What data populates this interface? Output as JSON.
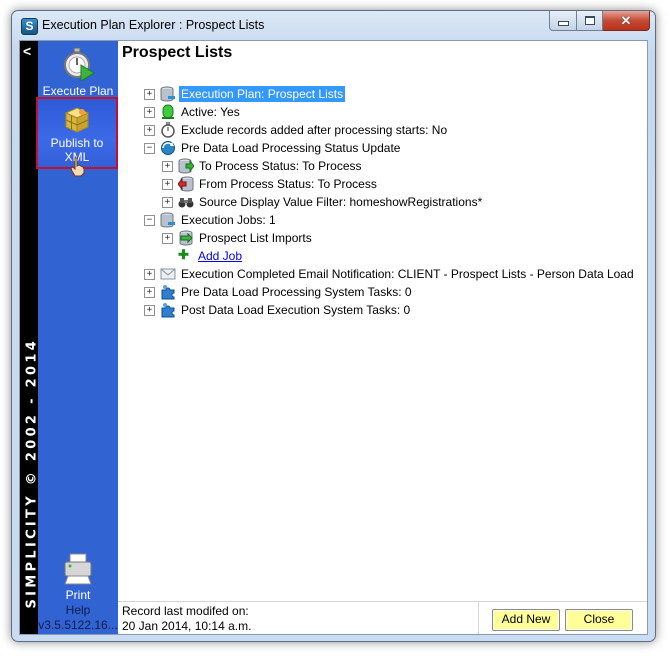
{
  "window": {
    "app_icon_letter": "S",
    "title": "Execution Plan Explorer : Prospect Lists",
    "controls": {
      "minimize": "minimize",
      "maximize": "maximize",
      "close": "✕"
    }
  },
  "sidebar": {
    "collapse_glyph": "<",
    "vertical_text": "SIMPLICITY © 2002 - 2014",
    "execute_plan_label": "Execute Plan",
    "publish_label_line1": "Publish to",
    "publish_label_line2": "XML",
    "print_label": "Print",
    "help_label": "Help",
    "version": "v3.5.5122.16..."
  },
  "main": {
    "title": "Prospect Lists",
    "tree": [
      {
        "label": "Execution Plan:  Prospect Lists",
        "expander": "+",
        "icon": "database-icon",
        "selected": true
      },
      {
        "label": "Active:  Yes",
        "expander": "+",
        "icon": "green-light-icon"
      },
      {
        "label": "Exclude records added after processing starts:  No",
        "expander": "+",
        "icon": "stopwatch-icon"
      },
      {
        "label": "Pre Data Load Processing Status Update",
        "expander": "−",
        "icon": "refresh-globe-icon"
      },
      {
        "label": "To Process Status:  To Process",
        "expander": "+",
        "icon": "database-green-arrow-icon"
      },
      {
        "label": "From Process Status:  To Process",
        "expander": "+",
        "icon": "database-red-arrow-icon"
      },
      {
        "label": "Source Display Value Filter:  homeshowRegistrations*",
        "expander": "+",
        "icon": "binoculars-icon"
      },
      {
        "label": "Execution Jobs:  1",
        "expander": "−",
        "icon": "database-icon"
      },
      {
        "label": "Prospect List Imports",
        "expander": "+",
        "icon": "job-icon"
      },
      {
        "label": "Add Job",
        "icon": "plus-icon",
        "link": true
      },
      {
        "label": "Execution Completed Email Notification:  CLIENT - Prospect Lists - Person Data Load",
        "expander": "+",
        "icon": "envelope-icon"
      },
      {
        "label": "Pre Data Load Processing System Tasks:  0",
        "expander": "+",
        "icon": "puzzle-icon"
      },
      {
        "label": "Post Data Load Execution System Tasks:  0",
        "expander": "+",
        "icon": "puzzle-icon"
      }
    ]
  },
  "footer": {
    "modified_label": "Record last modifed on:",
    "modified_value": "20 Jan 2014, 10:14 a.m.",
    "add_new_label": "Add New",
    "close_label": "Close"
  }
}
